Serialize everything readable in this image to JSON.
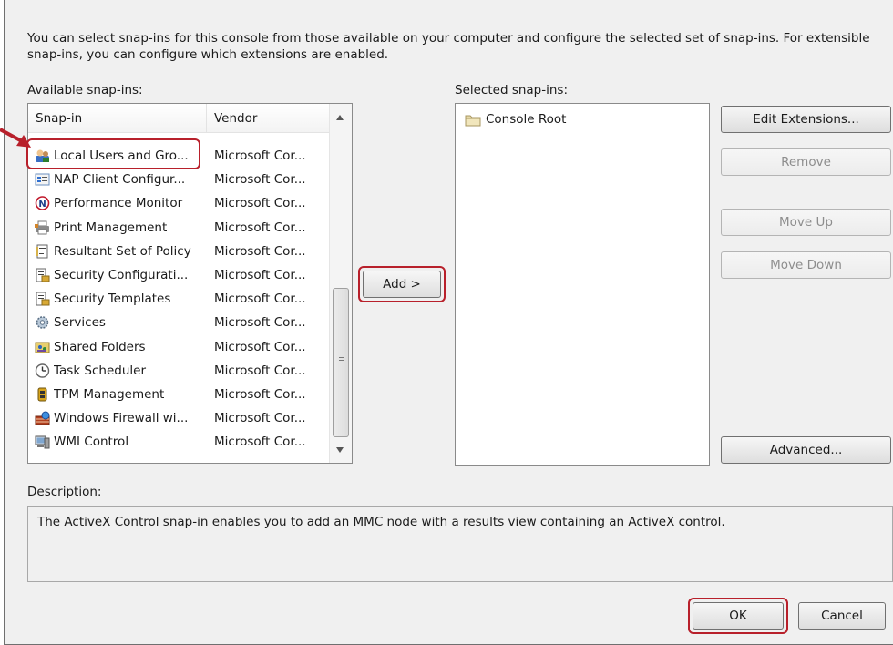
{
  "intro_text": "You can select snap-ins for this console from those available on your computer and configure the selected set of snap-ins. For extensible snap-ins, you can configure which extensions are enabled.",
  "available": {
    "label": "Available snap-ins:",
    "columns": {
      "snapin": "Snap-in",
      "vendor": "Vendor"
    },
    "rows": [
      {
        "name": "Local Users and Gro...",
        "vendor": "Microsoft Cor...",
        "icon": "users-icon"
      },
      {
        "name": "NAP Client Configur...",
        "vendor": "Microsoft Cor...",
        "icon": "nap-client-icon"
      },
      {
        "name": "Performance Monitor",
        "vendor": "Microsoft Cor...",
        "icon": "performance-monitor-icon"
      },
      {
        "name": "Print Management",
        "vendor": "Microsoft Cor...",
        "icon": "printer-icon"
      },
      {
        "name": "Resultant Set of Policy",
        "vendor": "Microsoft Cor...",
        "icon": "policy-document-icon"
      },
      {
        "name": "Security Configurati...",
        "vendor": "Microsoft Cor...",
        "icon": "security-config-icon"
      },
      {
        "name": "Security Templates",
        "vendor": "Microsoft Cor...",
        "icon": "security-templates-icon"
      },
      {
        "name": "Services",
        "vendor": "Microsoft Cor...",
        "icon": "services-gear-icon"
      },
      {
        "name": "Shared Folders",
        "vendor": "Microsoft Cor...",
        "icon": "shared-folders-icon"
      },
      {
        "name": "Task Scheduler",
        "vendor": "Microsoft Cor...",
        "icon": "clock-icon"
      },
      {
        "name": "TPM Management",
        "vendor": "Microsoft Cor...",
        "icon": "tpm-chip-icon"
      },
      {
        "name": "Windows Firewall wi...",
        "vendor": "Microsoft Cor...",
        "icon": "firewall-icon"
      },
      {
        "name": "WMI Control",
        "vendor": "Microsoft Cor...",
        "icon": "wmi-computer-icon"
      }
    ]
  },
  "add_button": "Add >",
  "selected": {
    "label": "Selected snap-ins:",
    "items": [
      {
        "name": "Console Root",
        "icon": "folder-icon"
      }
    ]
  },
  "side_buttons": {
    "edit_extensions": "Edit Extensions...",
    "remove": "Remove",
    "move_up": "Move Up",
    "move_down": "Move Down",
    "advanced": "Advanced..."
  },
  "description": {
    "label": "Description:",
    "text": "The ActiveX Control snap-in enables you to add an MMC node with a results view containing an ActiveX control."
  },
  "footer": {
    "ok": "OK",
    "cancel": "Cancel"
  },
  "colors": {
    "highlight_red": "#b8202b",
    "dialog_bg": "#f0f0f0"
  }
}
